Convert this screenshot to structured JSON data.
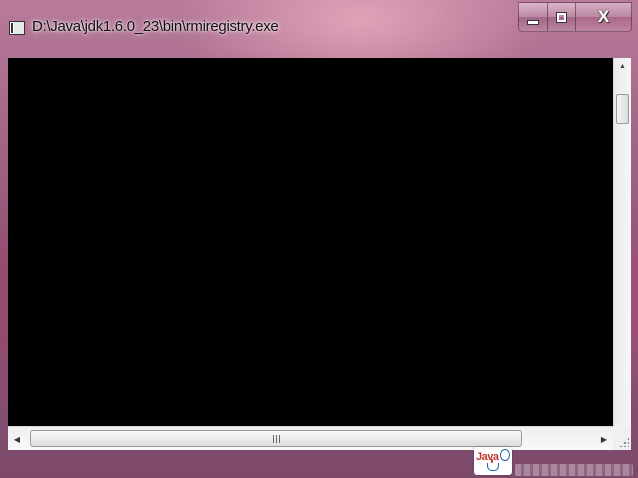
{
  "window": {
    "title": "D:\\Java\\jdk1.6.0_23\\bin\\rmiregistry.exe",
    "controls": {
      "minimize_icon": "minimize-icon",
      "maximize_icon": "maximize-icon",
      "close_label": "X"
    }
  },
  "console": {
    "background": "#000000",
    "text": ""
  },
  "logo": {
    "text": "Java"
  },
  "colors": {
    "frame": "#a06486",
    "console_bg": "#000000",
    "scrollbar": "#f0f0f0"
  }
}
